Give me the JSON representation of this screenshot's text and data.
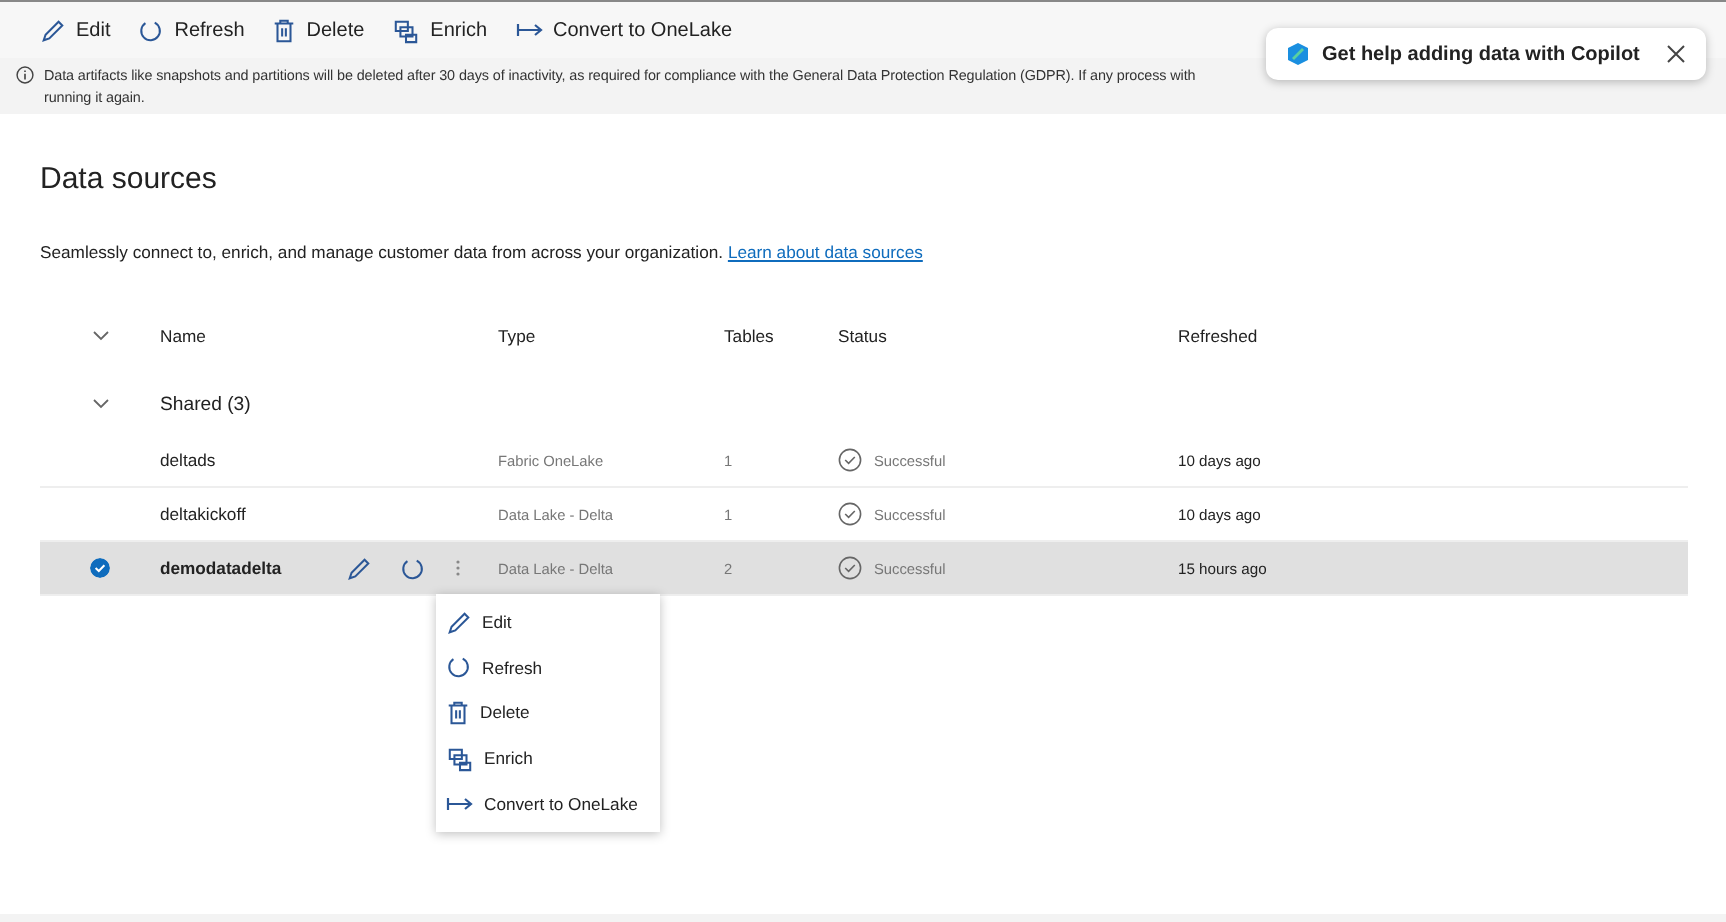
{
  "toolbar": [
    {
      "kind": "edit",
      "label": "Edit"
    },
    {
      "kind": "refresh",
      "label": "Refresh"
    },
    {
      "kind": "delete",
      "label": "Delete"
    },
    {
      "kind": "enrich",
      "label": "Enrich"
    },
    {
      "kind": "convert",
      "label": "Convert to OneLake"
    }
  ],
  "banner": {
    "lines": [
      "Data artifacts like snapshots and partitions will be deleted after 30 days of inactivity, as required for compliance with the General Data Protection Regulation (GDPR). If any process with",
      "running it again."
    ]
  },
  "copilot_popup": {
    "text": "Get help adding data with Copilot"
  },
  "page": {
    "title": "Data sources",
    "description": "Seamlessly connect to, enrich, and manage customer data from across your organization.",
    "link": "Learn about data sources"
  },
  "table": {
    "columns": [
      "Name",
      "Type",
      "Tables",
      "Status",
      "Refreshed"
    ],
    "group": {
      "label": "Shared (3)",
      "expanded": true
    },
    "rows": [
      {
        "name": "deltads",
        "type": "Fabric OneLake",
        "tables": "1",
        "status": "Successful",
        "refreshed": "10 days ago",
        "selected": false
      },
      {
        "name": "deltakickoff",
        "type": "Data Lake - Delta",
        "tables": "1",
        "status": "Successful",
        "refreshed": "10 days ago",
        "selected": false
      },
      {
        "name": "demodatadelta",
        "type": "Data Lake - Delta",
        "tables": "2",
        "status": "Successful",
        "refreshed": "15 hours ago",
        "selected": true
      }
    ]
  },
  "context_menu": [
    {
      "kind": "edit",
      "label": "Edit"
    },
    {
      "kind": "refresh",
      "label": "Refresh"
    },
    {
      "kind": "delete",
      "label": "Delete"
    },
    {
      "kind": "enrich",
      "label": "Enrich"
    },
    {
      "kind": "convert",
      "label": "Convert to OneLake"
    }
  ]
}
